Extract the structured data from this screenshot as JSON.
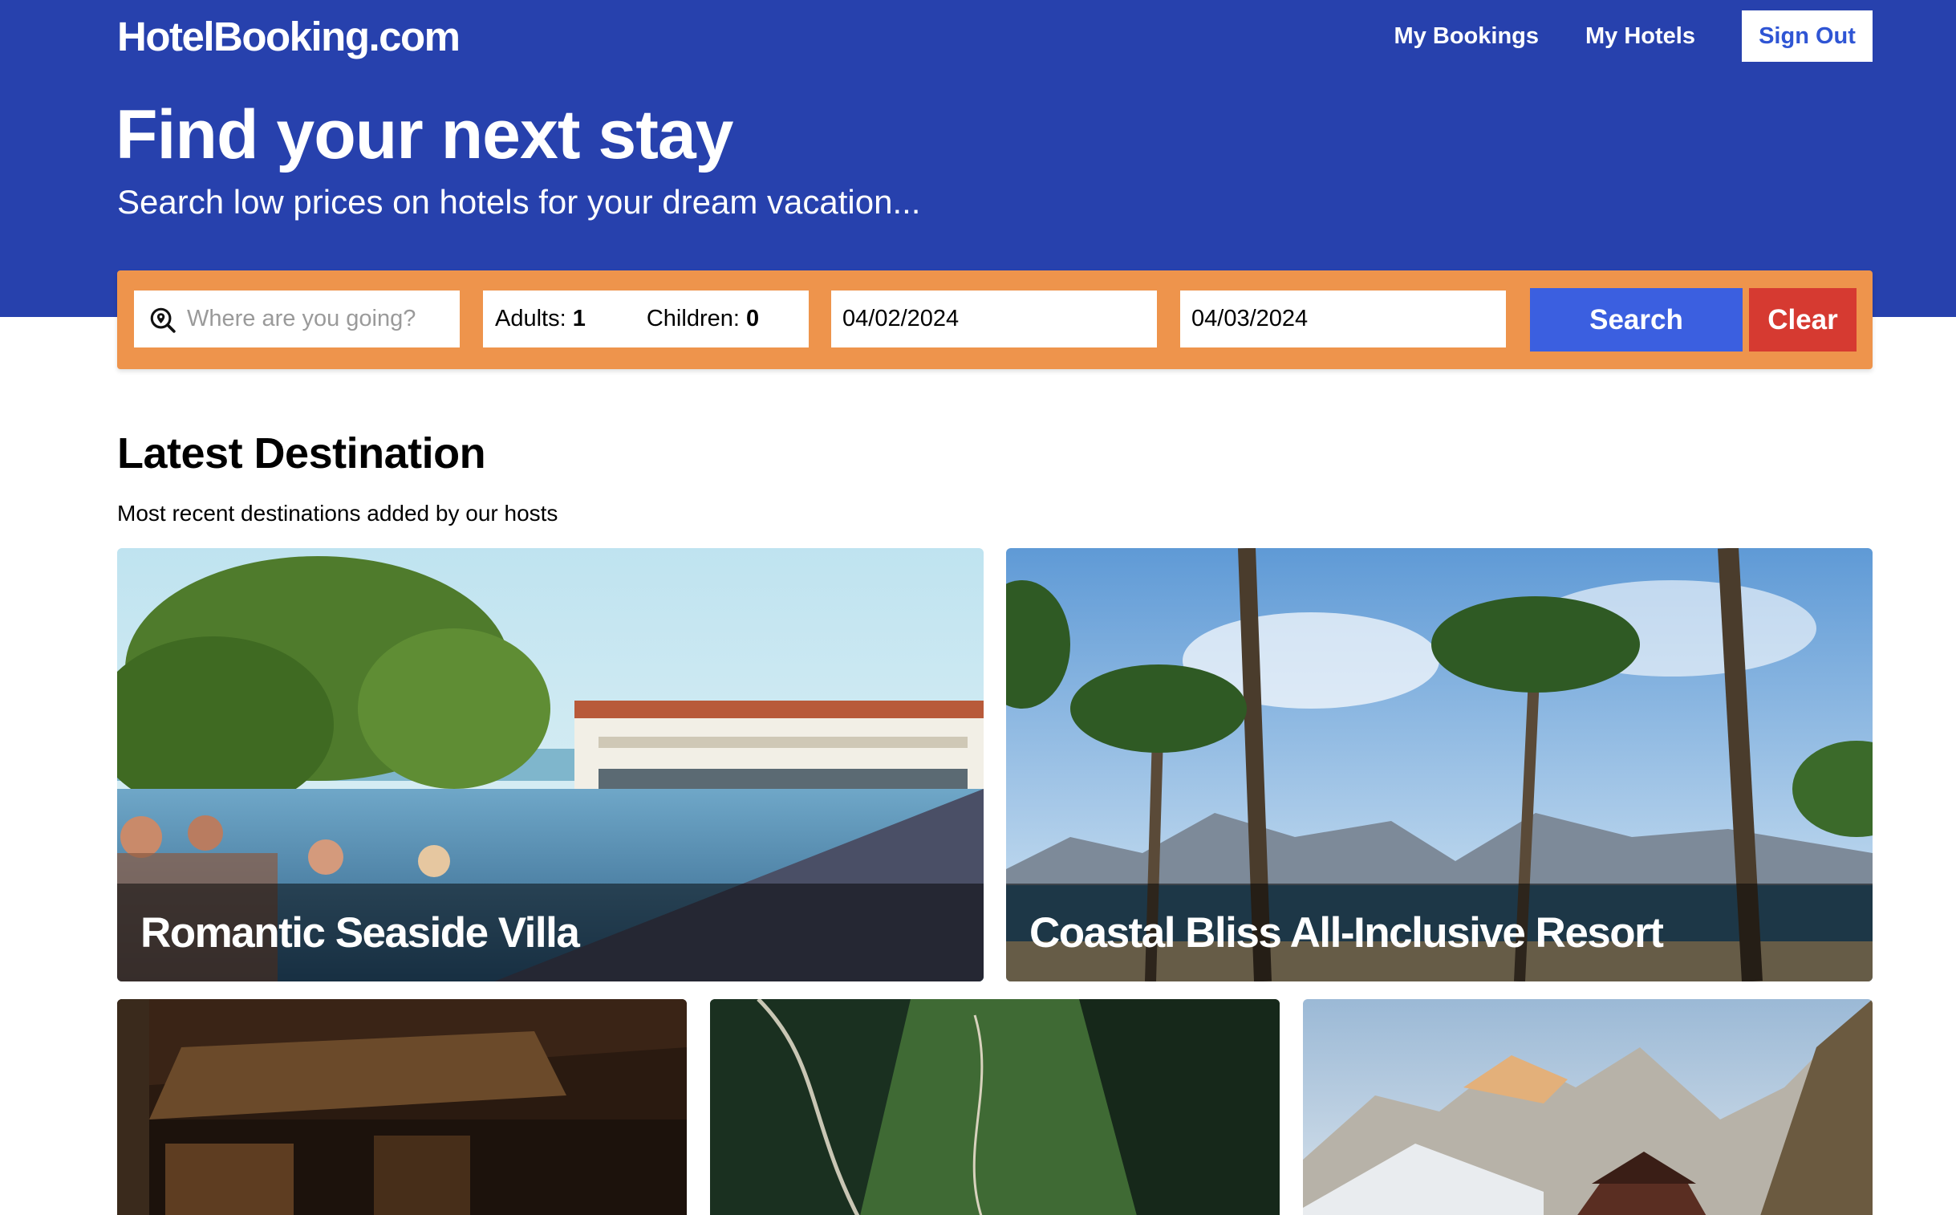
{
  "header": {
    "brand": "HotelBooking.com",
    "nav": {
      "my_bookings": "My Bookings",
      "my_hotels": "My Hotels",
      "sign_out": "Sign Out"
    },
    "title": "Find your next stay",
    "subtitle": "Search low prices on hotels for your dream vacation..."
  },
  "search": {
    "destination_placeholder": "Where are you going?",
    "adults_label": "Adults: ",
    "adults_value": "1",
    "children_label": "Children: ",
    "children_value": "0",
    "check_in": "04/02/2024",
    "check_out": "04/03/2024",
    "search_label": "Search",
    "clear_label": "Clear"
  },
  "section": {
    "title": "Latest Destination",
    "subtitle": "Most recent destinations added by our hosts"
  },
  "destinations": [
    {
      "name": "Romantic Seaside Villa"
    },
    {
      "name": "Coastal Bliss All-Inclusive Resort"
    },
    {
      "name": ""
    },
    {
      "name": ""
    },
    {
      "name": ""
    }
  ],
  "colors": {
    "header_bg": "#2741ad",
    "search_bar_bg": "#ee944c",
    "search_button": "#3b5fe0",
    "clear_button": "#d63a31"
  }
}
